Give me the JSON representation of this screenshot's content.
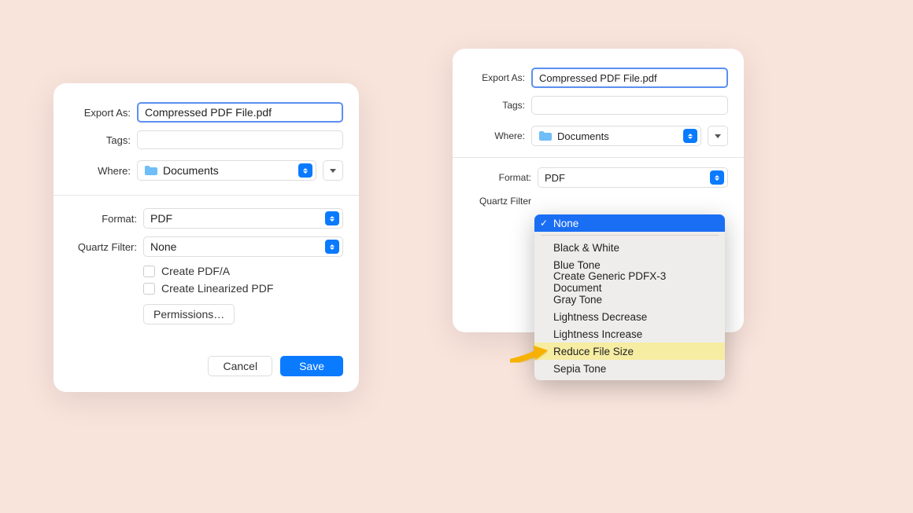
{
  "left_dialog": {
    "export_label": "Export As:",
    "filename": "Compressed PDF File.pdf",
    "tags_label": "Tags:",
    "tags_value": "",
    "where_label": "Where:",
    "where_value": "Documents",
    "format_label": "Format:",
    "format_value": "PDF",
    "quartz_label": "Quartz Filter:",
    "quartz_value": "None",
    "checkbox_pdfa": "Create PDF/A",
    "checkbox_linearized": "Create Linearized PDF",
    "permissions_label": "Permissions…",
    "cancel_label": "Cancel",
    "save_label": "Save"
  },
  "right_dialog": {
    "export_label": "Export As:",
    "filename": "Compressed PDF File.pdf",
    "tags_label": "Tags:",
    "tags_value": "",
    "where_label": "Where:",
    "where_value": "Documents",
    "format_label": "Format:",
    "format_value": "PDF",
    "quartz_label": "Quartz Filter"
  },
  "dropdown": {
    "items": [
      {
        "label": "None",
        "selected": true,
        "highlighted": false
      },
      {
        "label": "Black & White",
        "selected": false,
        "highlighted": false
      },
      {
        "label": "Blue Tone",
        "selected": false,
        "highlighted": false
      },
      {
        "label": "Create Generic PDFX-3 Document",
        "selected": false,
        "highlighted": false
      },
      {
        "label": "Gray Tone",
        "selected": false,
        "highlighted": false
      },
      {
        "label": "Lightness Decrease",
        "selected": false,
        "highlighted": false
      },
      {
        "label": "Lightness Increase",
        "selected": false,
        "highlighted": false
      },
      {
        "label": "Reduce File Size",
        "selected": false,
        "highlighted": true
      },
      {
        "label": "Sepia Tone",
        "selected": false,
        "highlighted": false
      }
    ]
  }
}
